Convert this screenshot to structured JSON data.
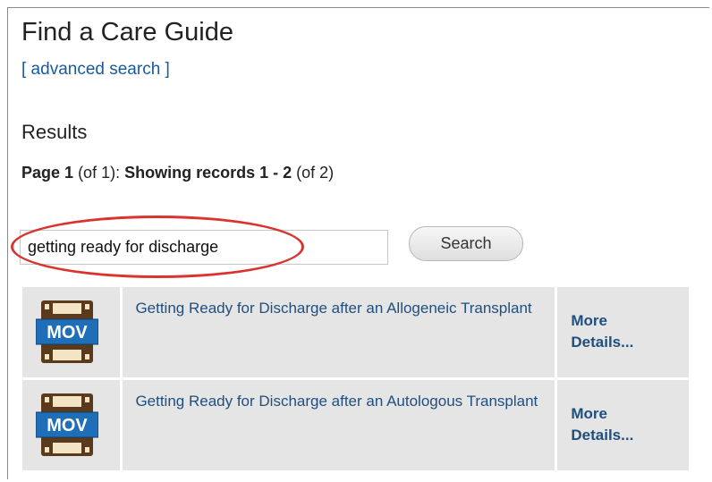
{
  "page": {
    "title": "Find a Care Guide",
    "advanced_search_label": "[ advanced search ]",
    "results_heading": "Results"
  },
  "paging": {
    "page_label": "Page 1",
    "page_of": "(of 1):",
    "showing_label": "Showing records 1 - 2",
    "total": "(of 2)"
  },
  "search": {
    "value": "getting ready for discharge",
    "button_label": "Search"
  },
  "results": [
    {
      "icon": "mov-film-icon",
      "icon_text": "MOV",
      "title": "Getting Ready for Discharge after an Allogeneic Transplant",
      "more_label": "More Details..."
    },
    {
      "icon": "mov-film-icon",
      "icon_text": "MOV",
      "title": "Getting Ready for Discharge after an Autologous Transplant",
      "more_label": "More Details..."
    }
  ],
  "colors": {
    "link": "#1f4f7f",
    "highlight_circle": "#d9342f",
    "row_background": "#e5e5e5",
    "icon_film": "#5a3a1a",
    "icon_badge": "#1e6fb8"
  }
}
